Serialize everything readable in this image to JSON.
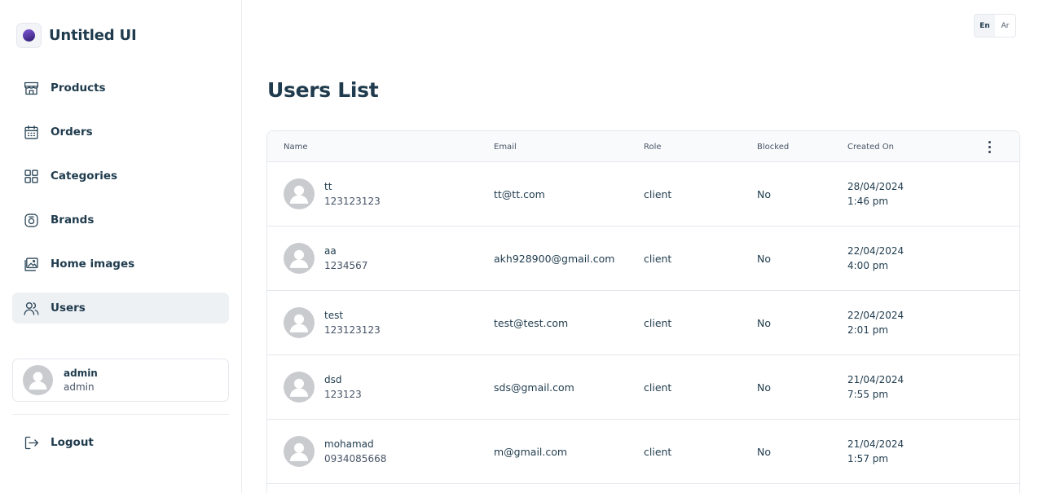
{
  "brand": {
    "name": "Untitled UI"
  },
  "sidebar": {
    "items": [
      {
        "label": "Products",
        "icon": "storefront-icon"
      },
      {
        "label": "Orders",
        "icon": "calendar-icon"
      },
      {
        "label": "Categories",
        "icon": "grid-icon"
      },
      {
        "label": "Brands",
        "icon": "instagram-icon"
      },
      {
        "label": "Home images",
        "icon": "gallery-icon"
      },
      {
        "label": "Users",
        "icon": "users-icon",
        "active": true
      }
    ],
    "profile": {
      "name": "admin",
      "role": "admin"
    },
    "logout_label": "Logout"
  },
  "language": {
    "en": "En",
    "ar": "Ar",
    "selected": "En"
  },
  "page": {
    "title": "Users List"
  },
  "table": {
    "columns": {
      "name": "Name",
      "email": "Email",
      "role": "Role",
      "blocked": "Blocked",
      "created": "Created On"
    },
    "rows": [
      {
        "name": "tt",
        "phone": "123123123",
        "email": "tt@tt.com",
        "role": "client",
        "blocked": "No",
        "date": "28/04/2024",
        "time": "1:46 pm"
      },
      {
        "name": "aa",
        "phone": "1234567",
        "email": "akh928900@gmail.com",
        "role": "client",
        "blocked": "No",
        "date": "22/04/2024",
        "time": "4:00 pm"
      },
      {
        "name": "test",
        "phone": "123123123",
        "email": "test@test.com",
        "role": "client",
        "blocked": "No",
        "date": "22/04/2024",
        "time": "2:01 pm"
      },
      {
        "name": "dsd",
        "phone": "123123",
        "email": "sds@gmail.com",
        "role": "client",
        "blocked": "No",
        "date": "21/04/2024",
        "time": "7:55 pm"
      },
      {
        "name": "mohamad",
        "phone": "0934085668",
        "email": "m@gmail.com",
        "role": "client",
        "blocked": "No",
        "date": "21/04/2024",
        "time": "1:57 pm"
      }
    ]
  },
  "colors": {
    "text": "#1f3b4d",
    "muted": "#475467",
    "border": "#e4e7ec",
    "active_bg": "#eef1f4",
    "avatar": "#c9cbcf"
  }
}
